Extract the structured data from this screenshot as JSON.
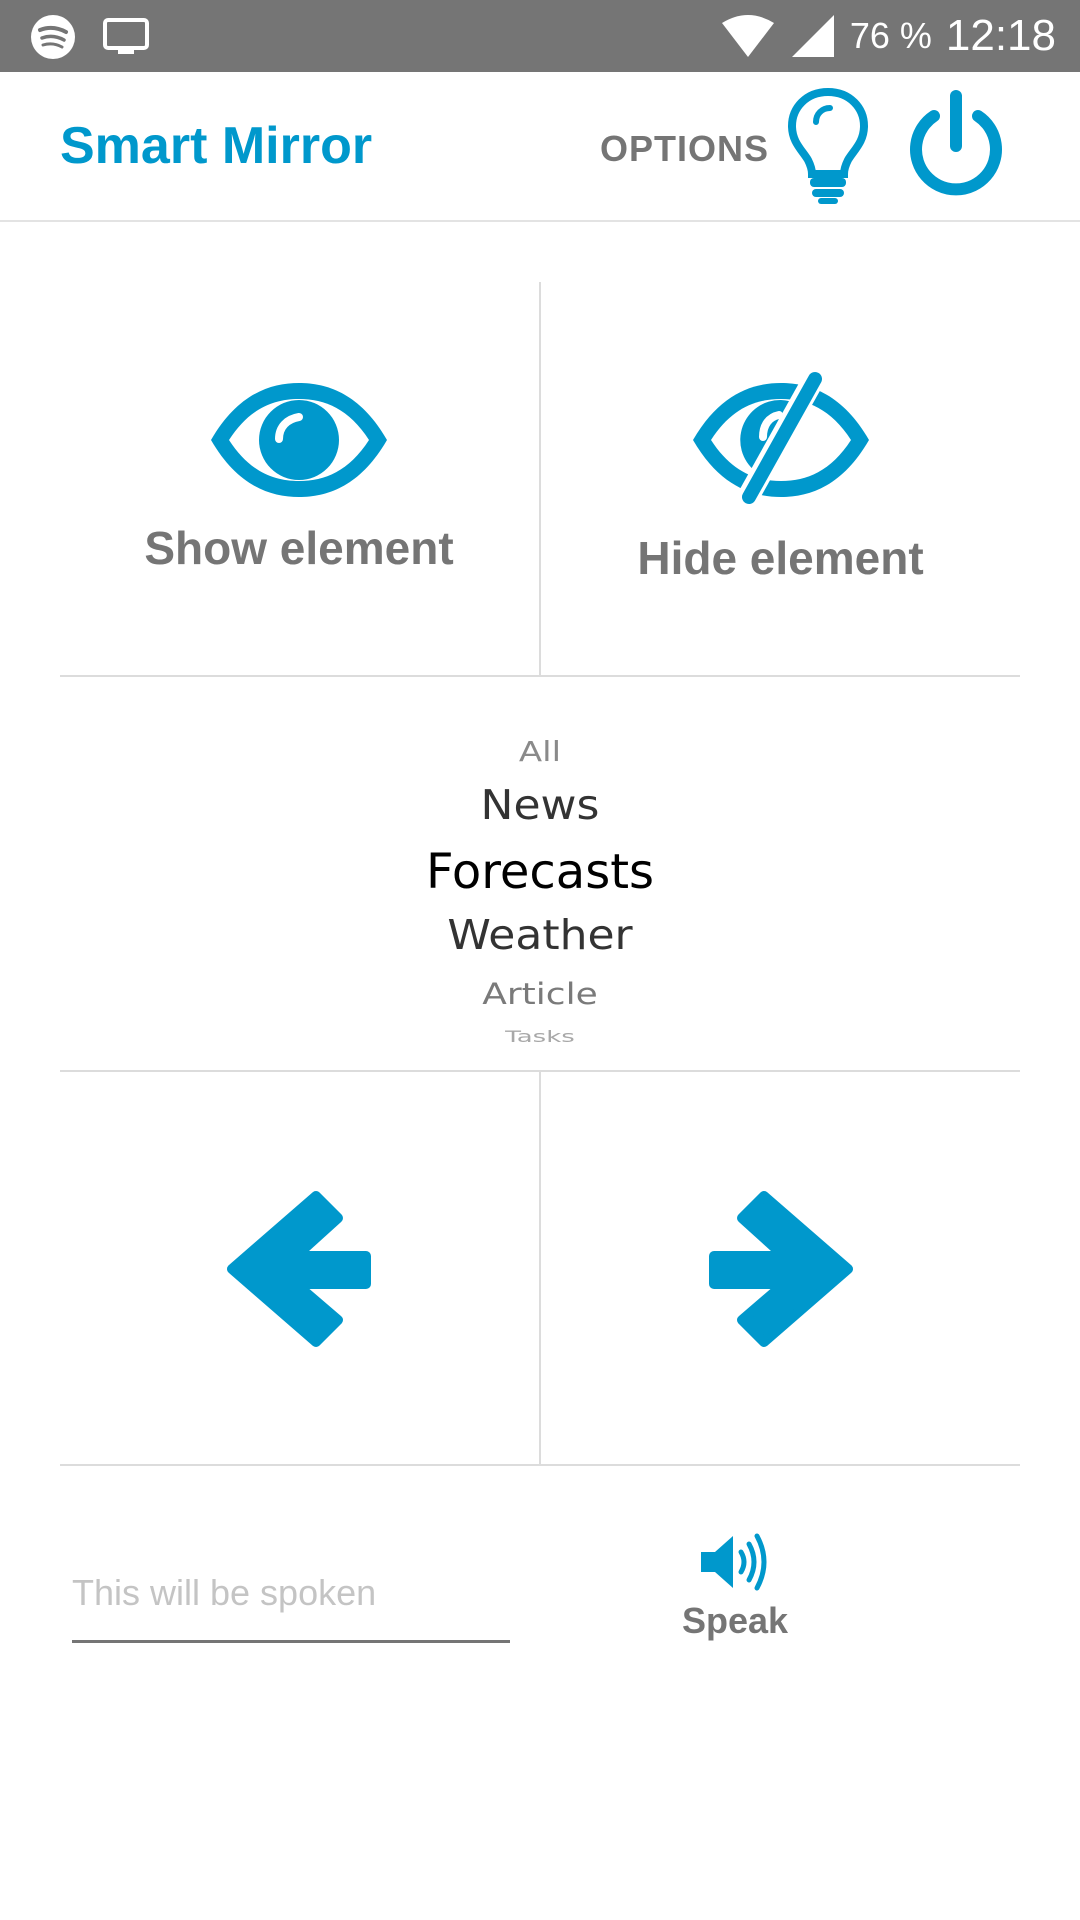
{
  "status_bar": {
    "battery": "76 %",
    "time": "12:18",
    "icons": [
      "spotify-icon",
      "cast-screen-icon",
      "wifi-icon",
      "cell-signal-icon"
    ]
  },
  "appbar": {
    "title": "Smart Mirror",
    "options_label": "OPTIONS",
    "icons": [
      "lightbulb-icon",
      "power-icon"
    ]
  },
  "colors": {
    "accent": "#0098cc",
    "status_bar": "#757575",
    "label_gray": "#757575",
    "divider": "#dcdcdc"
  },
  "controls": {
    "show_label": "Show element",
    "hide_label": "Hide element",
    "show_icon": "eye-icon",
    "hide_icon": "eye-slash-icon",
    "prev_icon": "arrow-left-icon",
    "next_icon": "arrow-right-icon"
  },
  "picker": {
    "items": [
      "All",
      "News",
      "Forecasts",
      "Weather",
      "Article",
      "Tasks"
    ],
    "selected": "Forecasts"
  },
  "speak": {
    "placeholder": "This will be spoken",
    "value": "",
    "button_label": "Speak",
    "icon": "speaker-icon"
  }
}
